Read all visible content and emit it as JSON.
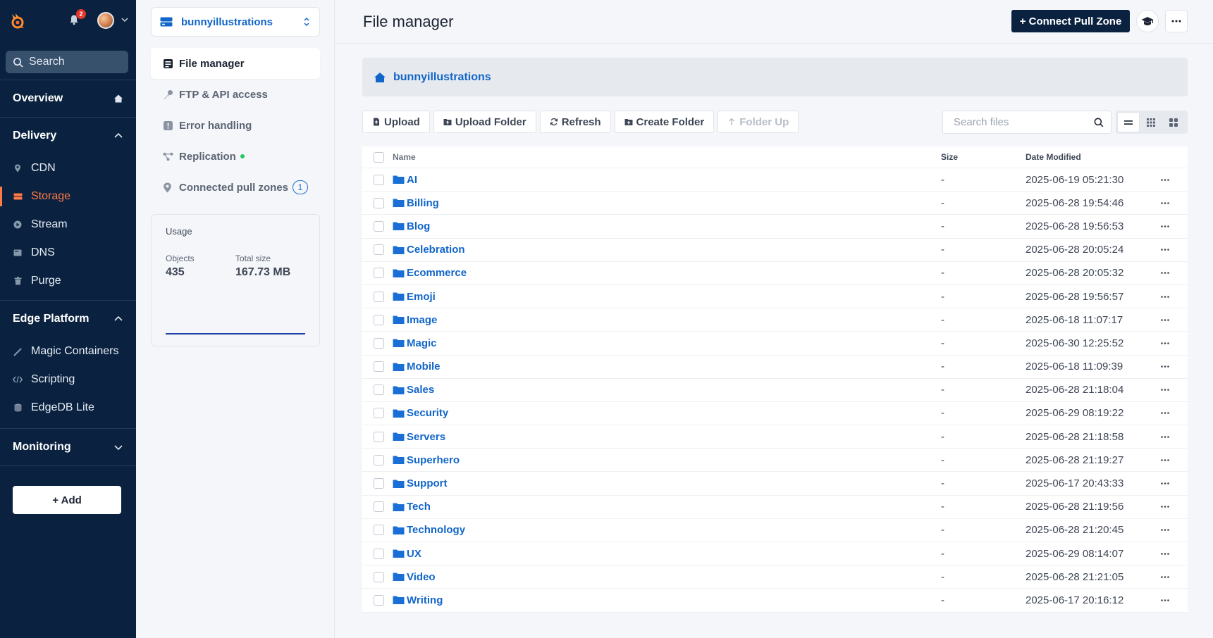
{
  "sidebar": {
    "notifications_count": "2",
    "search_placeholder": "Search",
    "overview_label": "Overview",
    "delivery": {
      "label": "Delivery",
      "items": [
        {
          "label": "CDN",
          "icon": "pin-icon"
        },
        {
          "label": "Storage",
          "icon": "storage-icon"
        },
        {
          "label": "Stream",
          "icon": "play-icon"
        },
        {
          "label": "DNS",
          "icon": "dns-icon"
        },
        {
          "label": "Purge",
          "icon": "trash-icon"
        }
      ]
    },
    "edge_platform": {
      "label": "Edge Platform",
      "items": [
        {
          "label": "Magic Containers",
          "icon": "wand-icon"
        },
        {
          "label": "Scripting",
          "icon": "code-icon"
        },
        {
          "label": "EdgeDB Lite",
          "icon": "database-icon"
        }
      ]
    },
    "monitoring_label": "Monitoring",
    "add_label": "+ Add"
  },
  "panel": {
    "zone_name": "bunnyillustrations",
    "nav": [
      {
        "label": "File manager"
      },
      {
        "label": "FTP & API access"
      },
      {
        "label": "Error handling"
      },
      {
        "label": "Replication"
      },
      {
        "label": "Connected pull zones",
        "badge": "1"
      }
    ],
    "usage": {
      "title": "Usage",
      "objects_label": "Objects",
      "objects_value": "435",
      "size_label": "Total size",
      "size_value": "167.73 MB"
    }
  },
  "header": {
    "title": "File manager",
    "connect_label": "+ Connect Pull Zone"
  },
  "breadcrumb": {
    "root": "bunnyillustrations"
  },
  "toolbar": {
    "upload": "Upload",
    "upload_folder": "Upload Folder",
    "refresh": "Refresh",
    "create_folder": "Create Folder",
    "folder_up": "Folder Up",
    "search_placeholder": "Search files"
  },
  "table": {
    "columns": {
      "name": "Name",
      "size": "Size",
      "date": "Date Modified"
    },
    "rows": [
      {
        "name": "AI",
        "size": "-",
        "date": "2025-06-19 05:21:30"
      },
      {
        "name": "Billing",
        "size": "-",
        "date": "2025-06-28 19:54:46"
      },
      {
        "name": "Blog",
        "size": "-",
        "date": "2025-06-28 19:56:53"
      },
      {
        "name": "Celebration",
        "size": "-",
        "date": "2025-06-28 20:05:24"
      },
      {
        "name": "Ecommerce",
        "size": "-",
        "date": "2025-06-28 20:05:32"
      },
      {
        "name": "Emoji",
        "size": "-",
        "date": "2025-06-28 19:56:57"
      },
      {
        "name": "Image",
        "size": "-",
        "date": "2025-06-18 11:07:17"
      },
      {
        "name": "Magic",
        "size": "-",
        "date": "2025-06-30 12:25:52"
      },
      {
        "name": "Mobile",
        "size": "-",
        "date": "2025-06-18 11:09:39"
      },
      {
        "name": "Sales",
        "size": "-",
        "date": "2025-06-28 21:18:04"
      },
      {
        "name": "Security",
        "size": "-",
        "date": "2025-06-29 08:19:22"
      },
      {
        "name": "Servers",
        "size": "-",
        "date": "2025-06-28 21:18:58"
      },
      {
        "name": "Superhero",
        "size": "-",
        "date": "2025-06-28 21:19:27"
      },
      {
        "name": "Support",
        "size": "-",
        "date": "2025-06-17 20:43:33"
      },
      {
        "name": "Tech",
        "size": "-",
        "date": "2025-06-28 21:19:56"
      },
      {
        "name": "Technology",
        "size": "-",
        "date": "2025-06-28 21:20:45"
      },
      {
        "name": "UX",
        "size": "-",
        "date": "2025-06-29 08:14:07"
      },
      {
        "name": "Video",
        "size": "-",
        "date": "2025-06-28 21:21:05"
      },
      {
        "name": "Writing",
        "size": "-",
        "date": "2025-06-17 20:16:12"
      }
    ]
  },
  "colors": {
    "sidebar_bg": "#0a2240",
    "accent_orange": "#ff7a45",
    "link_blue": "#1266c9",
    "folder_blue": "#1a6fd6"
  }
}
